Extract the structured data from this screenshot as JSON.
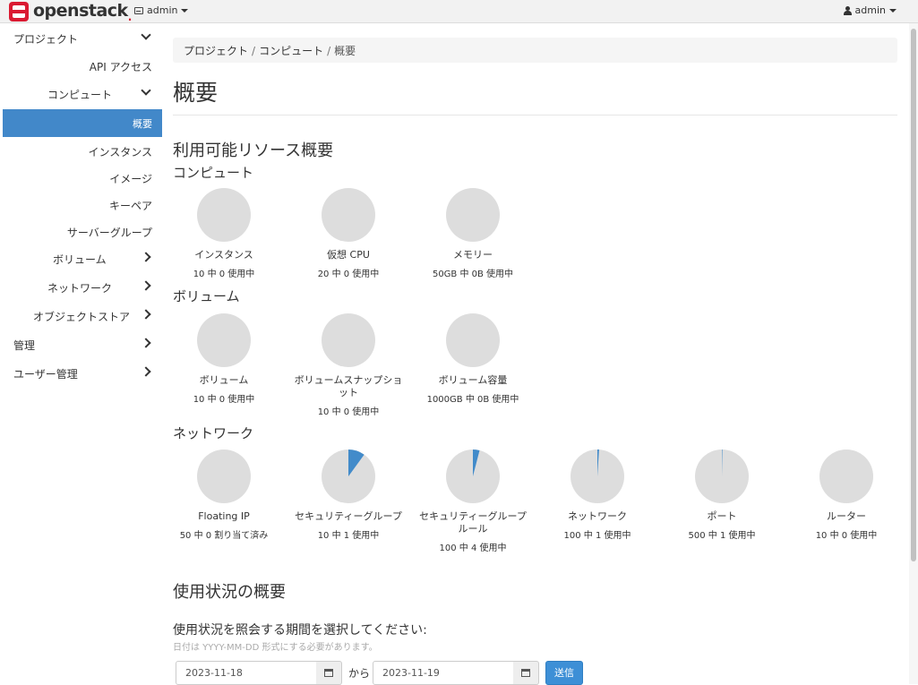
{
  "header": {
    "brand": "openstack",
    "brand_dot": ".",
    "project": "admin",
    "user": "admin"
  },
  "sidebar": {
    "items": [
      {
        "label": "プロジェクト",
        "chevron": "down"
      },
      {
        "label": "API アクセス"
      },
      {
        "label": "コンピュート",
        "chevron": "down"
      },
      {
        "label": "概要",
        "active": true
      },
      {
        "label": "インスタンス"
      },
      {
        "label": "イメージ"
      },
      {
        "label": "キーペア"
      },
      {
        "label": "サーバーグループ"
      },
      {
        "label": "ボリューム",
        "chevron": "right"
      },
      {
        "label": "ネットワーク",
        "chevron": "right"
      },
      {
        "label": "オブジェクトストア",
        "chevron": "right"
      },
      {
        "label": "管理",
        "chevron": "right"
      },
      {
        "label": "ユーザー管理",
        "chevron": "right"
      }
    ]
  },
  "breadcrumb": [
    "プロジェクト",
    "コンピュート",
    "概要"
  ],
  "breadcrumb_sep": "/",
  "page_title": "概要",
  "limits": {
    "title": "利用可能リソース概要",
    "groups": [
      {
        "title": "コンピュート",
        "items": [
          {
            "label": "インスタンス",
            "usage": "10 中 0 使用中",
            "fraction": 0
          },
          {
            "label": "仮想 CPU",
            "usage": "20 中 0 使用中",
            "fraction": 0
          },
          {
            "label": "メモリー",
            "usage": "50GB 中 0B 使用中",
            "fraction": 0
          }
        ]
      },
      {
        "title": "ボリューム",
        "items": [
          {
            "label": "ボリューム",
            "usage": "10 中 0 使用中",
            "fraction": 0
          },
          {
            "label": "ボリュームスナップショット",
            "usage": "10 中 0 使用中",
            "fraction": 0
          },
          {
            "label": "ボリューム容量",
            "usage": "1000GB 中 0B 使用中",
            "fraction": 0
          }
        ]
      },
      {
        "title": "ネットワーク",
        "items": [
          {
            "label": "Floating IP",
            "usage": "50 中 0 割り当て済み",
            "fraction": 0
          },
          {
            "label": "セキュリティーグループ",
            "usage": "10 中 1 使用中",
            "fraction": 0.1
          },
          {
            "label": "セキュリティーグループルール",
            "usage": "100 中 4 使用中",
            "fraction": 0.04
          },
          {
            "label": "ネットワーク",
            "usage": "100 中 1 使用中",
            "fraction": 0.01
          },
          {
            "label": "ポート",
            "usage": "500 中 1 使用中",
            "fraction": 0.002
          },
          {
            "label": "ルーター",
            "usage": "10 中 0 使用中",
            "fraction": 0
          }
        ]
      }
    ]
  },
  "usage": {
    "title": "使用状況の概要",
    "prompt": "使用状況を照会する期間を選択してください:",
    "help": "日付は YYYY-MM-DD 形式にする必要があります。",
    "start": "2023-11-18",
    "from_label": "から",
    "end": "2023-11-19",
    "submit": "送信"
  },
  "colors": {
    "pie_bg": "#dddddd",
    "pie_fill": "#428bca",
    "active_nav": "#4288c9"
  }
}
